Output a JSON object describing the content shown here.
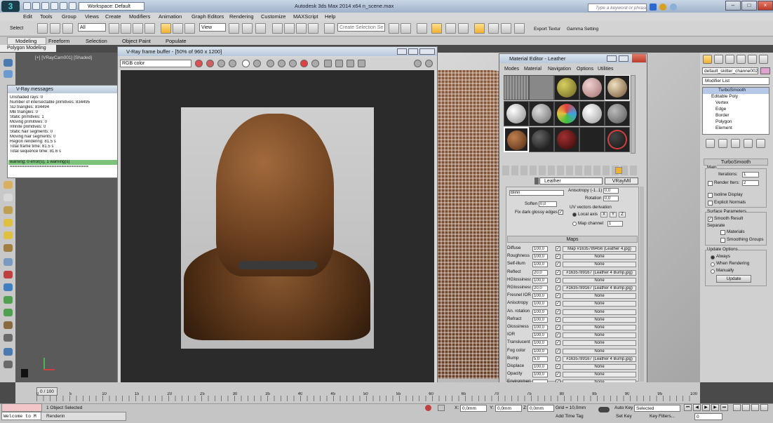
{
  "app": {
    "title": "Autodesk 3ds Max 2014 x64    n_scene.max",
    "workspace": "Workspace: Default",
    "search_placeholder": "Type a keyword or phrase"
  },
  "menubar": [
    "Edit",
    "Tools",
    "Group",
    "Views",
    "Create",
    "Modifiers",
    "Animation",
    "Graph Editors",
    "Rendering",
    "Customize",
    "MAXScript",
    "Help"
  ],
  "toolbar": {
    "selectset": "Select",
    "filter": "All",
    "view": "View",
    "create_selection": "Create Selection Se",
    "export_label": "Export Textur",
    "gamma_label": "Gamma Setting"
  },
  "ribbon": {
    "tabs": [
      "Modeling",
      "Freeform",
      "Selection",
      "Object Paint",
      "Populate"
    ],
    "sub": "Polygon Modeling"
  },
  "viewport": {
    "label": "[+] [VRayCam001] [Shaded]"
  },
  "vfb": {
    "title": "V-Ray frame buffer - [50% of 960 x 1200]",
    "channel": "RGB color"
  },
  "vray_messages": {
    "title": "V-Ray messages",
    "lines": [
      "Unshaded rays: 0",
      "Number of intersectable primitives: 834495",
      "  SD triangles: 834494",
      "  MB triangles: 0",
      "  Static primitives: 1",
      "  Moving primitives: 0",
      "  Infinite primitives: 0",
      "  Static hair segments: 0",
      "  Moving hair segments: 0",
      "Region rendering: 81.5 s",
      "Total frame time: 81.5 s",
      "Total sequence time: 81.6 s",
      "warning: 0 error(s), 1 warning(s)",
      "================================"
    ]
  },
  "material_editor": {
    "title": "Material Editor - Leather",
    "menus": [
      "Modes",
      "Material",
      "Navigation",
      "Options",
      "Utilities"
    ],
    "material_name": "Leather",
    "material_type": "VRayMtl",
    "brdf": "Blinn",
    "soften_label": "Soften",
    "soften": "0,0",
    "fix_dark": "Fix dark glossy edges",
    "anisotropy_label": "Anisotropy (-1..1)",
    "anisotropy": "0,0",
    "rotation_label": "Rotation",
    "rotation": "0,0",
    "uv_label": "UV vectors derivation",
    "local_axis": "Local axis",
    "axes": [
      "X",
      "Y",
      "Z"
    ],
    "map_channel_label": "Map channel",
    "map_channel": "1",
    "maps_title": "Maps",
    "maps": [
      {
        "name": "Diffuse",
        "amount": "100,0",
        "map": "Map #1635789456 (Leather 4.jpg)"
      },
      {
        "name": "Roughness",
        "amount": "100,0",
        "map": "None"
      },
      {
        "name": "Self-illum",
        "amount": "100,0",
        "map": "None"
      },
      {
        "name": "Reflect",
        "amount": "20,0",
        "map": "#1635789167 (Leather 4 Bump.jpg)"
      },
      {
        "name": "HGlossiness",
        "amount": "100,0",
        "map": "None"
      },
      {
        "name": "RGlossiness",
        "amount": "20,0",
        "map": "#1635789167 (Leather 4 Bump.jpg)"
      },
      {
        "name": "Fresnel IOR",
        "amount": "100,0",
        "map": "None"
      },
      {
        "name": "Anisotropy",
        "amount": "100,0",
        "map": "None"
      },
      {
        "name": "An. rotation",
        "amount": "100,0",
        "map": "None"
      },
      {
        "name": "Refract",
        "amount": "100,0",
        "map": "None"
      },
      {
        "name": "Glossiness",
        "amount": "100,0",
        "map": "None"
      },
      {
        "name": "IOR",
        "amount": "100,0",
        "map": "None"
      },
      {
        "name": "Translucent",
        "amount": "100,0",
        "map": "None"
      },
      {
        "name": "Fog color",
        "amount": "100,0",
        "map": "None"
      },
      {
        "name": "Bump",
        "amount": "5,0",
        "map": "#1635789167 (Leather 4 Bump.jpg)"
      },
      {
        "name": "Displace",
        "amount": "100,0",
        "map": "None"
      },
      {
        "name": "Opacity",
        "amount": "100,0",
        "map": "None"
      },
      {
        "name": "Environment",
        "amount": "",
        "map": "None"
      }
    ]
  },
  "command_panel": {
    "object_name": "default_skitter_channe002",
    "modifier_list": "Modifier List",
    "stack": [
      "TurboSmooth",
      "Editable Poly",
      "Vertex",
      "Edge",
      "Border",
      "Polygon",
      "Element"
    ],
    "turbosmooth_title": "TurboSmooth",
    "main_label": "Main",
    "iterations_label": "Iterations:",
    "iterations": "1",
    "render_iters_label": "Render Iters:",
    "render_iters": "2",
    "isoline": "Isoline Display",
    "explicit_normals": "Explicit Normals",
    "surface_params": "Surface Parameters",
    "smooth_result": "Smooth Result",
    "separate": "Separate",
    "materials": "Materials",
    "smoothing_groups": "Smoothing Groups",
    "update_options": "Update Options",
    "always": "Always",
    "when_rendering": "When Rendering",
    "manually": "Manually",
    "update_btn": "Update"
  },
  "timeline": {
    "slider": "0 / 100",
    "ticks": [
      "0",
      "5",
      "10",
      "15",
      "20",
      "25",
      "30",
      "35",
      "40",
      "45",
      "50",
      "55",
      "60",
      "65",
      "70",
      "75",
      "80",
      "85",
      "90",
      "95",
      "100"
    ]
  },
  "status": {
    "selected": "1 Object Selected",
    "rendering": "Renderin",
    "welcome": "Welcome to M",
    "x": "0,0mm",
    "y": "0,0mm",
    "z": "0,0mm",
    "grid": "Grid = 10,0mm",
    "add_time_tag": "Add Time Tag",
    "auto_key": "Auto Key",
    "selected_dd": "Selected",
    "set_key": "Set Key",
    "key_filters": "Key Filters...",
    "frame": "0"
  }
}
